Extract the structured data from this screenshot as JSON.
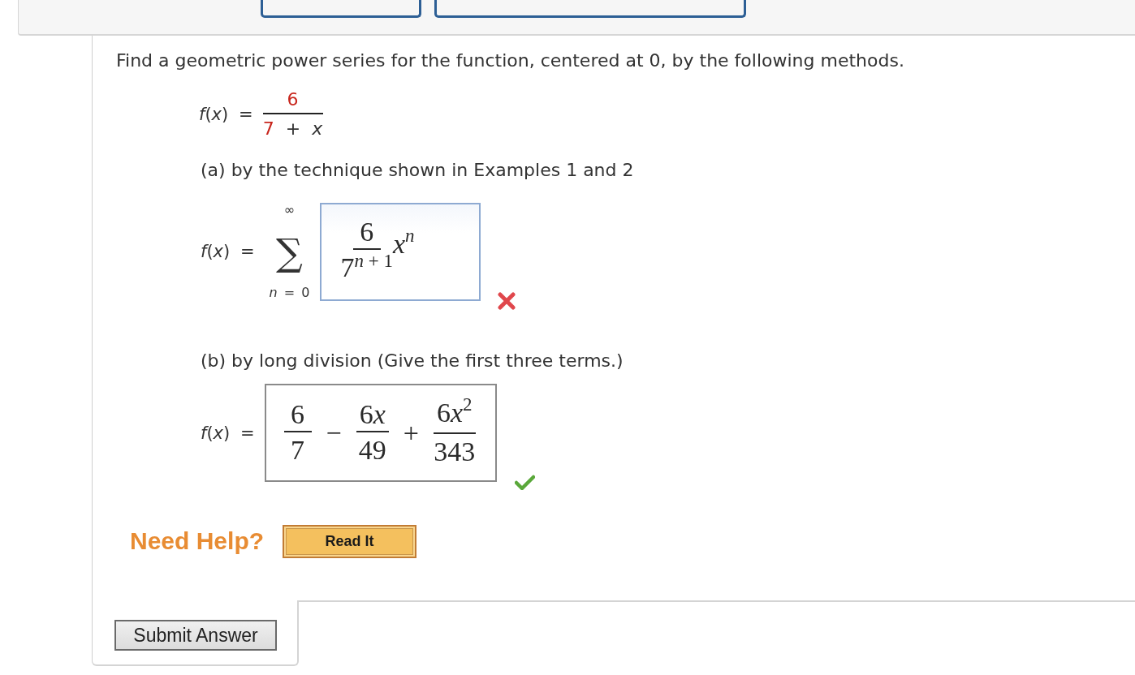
{
  "question": {
    "prompt": "Find a geometric power series for the function, centered at 0, by the following methods.",
    "function": {
      "label": "*f*(*x*) =",
      "numerator": [
        {
          "text": "6",
          "highlighted": true
        }
      ],
      "denominator": [
        {
          "text": "7",
          "highlighted": true
        },
        {
          "text": "+",
          "highlighted": false
        },
        {
          "text": "*x*",
          "highlighted": false
        }
      ]
    }
  },
  "parts": [
    {
      "label": "(a) by the technique shown in Examples 1 and 2",
      "kind": "series",
      "lhs": "*f*(*x*) =",
      "sum": {
        "symbol": "∑",
        "upper": "∞",
        "lower": "*n* = 0"
      },
      "answer": [
        {
          "kind": "fraction",
          "numerator": [
            {
              "kind": "number",
              "text": "6"
            }
          ],
          "denominator": [
            {
              "kind": "number",
              "text": "7"
            }
          ],
          "denominator_exponent": "*n* + 1"
        },
        {
          "kind": "power",
          "base": "*x*",
          "exponent": "*n*"
        }
      ],
      "correct": false
    },
    {
      "label": "(b) by long division (Give the first three terms.)",
      "kind": "terms",
      "lhs": "*f*(*x*) =",
      "answer": [
        {
          "kind": "fraction",
          "numerator": [
            {
              "kind": "number",
              "text": "6"
            }
          ],
          "denominator": [
            {
              "kind": "number",
              "text": "7"
            }
          ]
        },
        {
          "kind": "operator",
          "text": "−"
        },
        {
          "kind": "fraction",
          "numerator": [
            {
              "kind": "number",
              "text": "6"
            },
            {
              "kind": "variable",
              "text": "x"
            }
          ],
          "denominator": [
            {
              "kind": "number",
              "text": "49"
            }
          ]
        },
        {
          "kind": "operator",
          "text": "+"
        },
        {
          "kind": "fraction",
          "numerator": [
            {
              "kind": "number",
              "text": "6"
            },
            {
              "kind": "variable",
              "text": "x"
            }
          ],
          "numerator_exponent": "2",
          "denominator": [
            {
              "kind": "number",
              "text": "343"
            }
          ]
        }
      ],
      "correct": true
    }
  ],
  "help": {
    "label": "Need Help?",
    "buttons": [
      "Read It"
    ]
  },
  "submit": {
    "label": "Submit Answer"
  }
}
